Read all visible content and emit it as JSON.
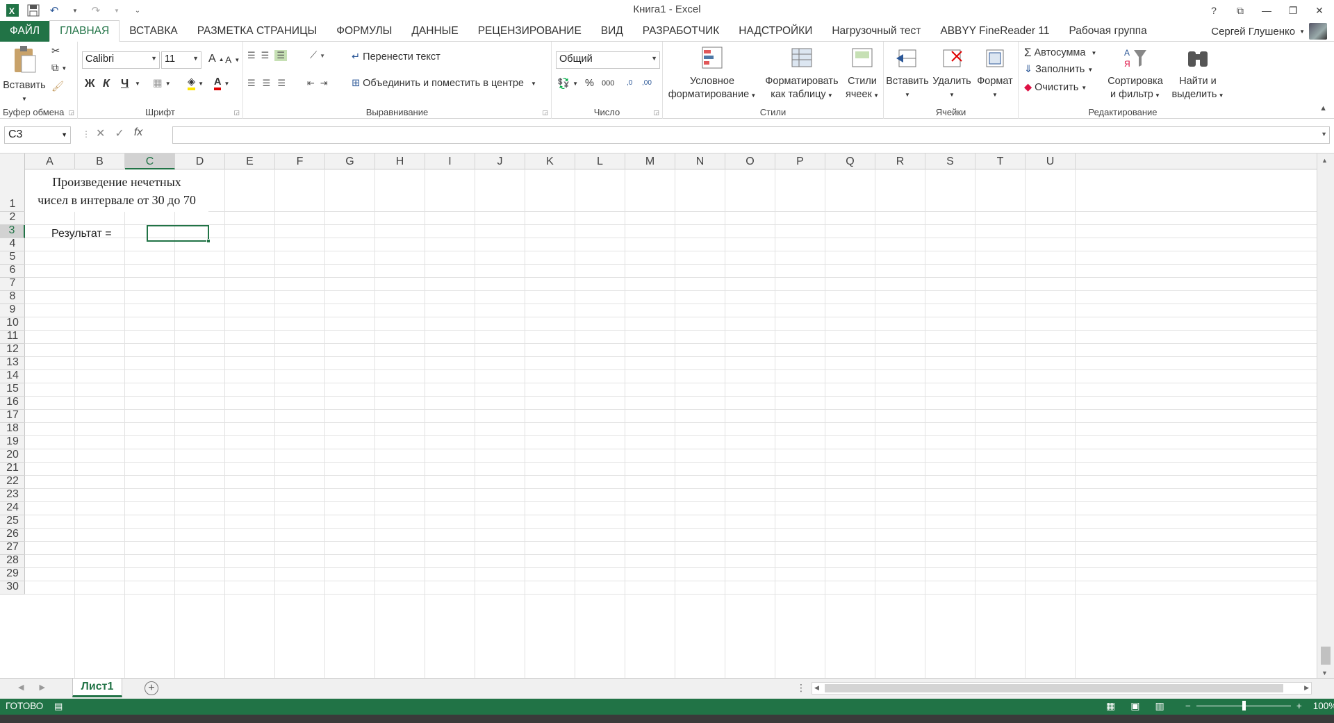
{
  "window": {
    "title": "Книга1 - Excel",
    "controls": [
      "?",
      "⧉",
      "—",
      "❐",
      "✕"
    ]
  },
  "quick_access": {
    "icons": [
      "excel-logo-icon",
      "save-icon",
      "undo-icon",
      "redo-icon",
      "customize-icon"
    ]
  },
  "tabs": [
    {
      "label": "ФАЙЛ"
    },
    {
      "label": "ГЛАВНАЯ"
    },
    {
      "label": "ВСТАВКА"
    },
    {
      "label": "РАЗМЕТКА СТРАНИЦЫ"
    },
    {
      "label": "ФОРМУЛЫ"
    },
    {
      "label": "ДАННЫЕ"
    },
    {
      "label": "РЕЦЕНЗИРОВАНИЕ"
    },
    {
      "label": "ВИД"
    },
    {
      "label": "РАЗРАБОТЧИК"
    },
    {
      "label": "НАДСТРОЙКИ"
    },
    {
      "label": "Нагрузочный тест"
    },
    {
      "label": "ABBYY FineReader 11"
    },
    {
      "label": "Рабочая группа"
    }
  ],
  "user": {
    "name": "Сергей Глушенко"
  },
  "ribbon": {
    "clipboard": {
      "group_label": "Буфер обмена",
      "paste_label": "Вставить"
    },
    "font": {
      "group_label": "Шрифт",
      "font_name": "Calibri",
      "font_size": "11",
      "bold": "Ж",
      "italic": "К",
      "underline": "Ч",
      "grow": "A",
      "shrink": "A",
      "font_color_letter": "A"
    },
    "alignment": {
      "group_label": "Выравнивание",
      "wrap_text": "Перенести текст",
      "merge_center": "Объединить и поместить в центре"
    },
    "number": {
      "group_label": "Число",
      "format": "Общий",
      "percent": "%",
      "thousands": "000",
      "inc_decimal": ",0",
      "dec_decimal": ",00"
    },
    "styles": {
      "group_label": "Стили",
      "conditional_1": "Условное",
      "conditional_2": "форматирование",
      "format_table_1": "Форматировать",
      "format_table_2": "как таблицу",
      "cell_styles_1": "Стили",
      "cell_styles_2": "ячеек"
    },
    "cells": {
      "group_label": "Ячейки",
      "insert": "Вставить",
      "delete": "Удалить",
      "format": "Формат"
    },
    "editing": {
      "group_label": "Редактирование",
      "autosum": "Автосумма",
      "fill": "Заполнить",
      "clear": "Очистить",
      "sort_1": "Сортировка",
      "sort_2": "и фильтр",
      "find_1": "Найти и",
      "find_2": "выделить"
    }
  },
  "formula_bar": {
    "name_box": "C3",
    "formula": "",
    "fx": "fx"
  },
  "columns": [
    "A",
    "B",
    "C",
    "D",
    "E",
    "F",
    "G",
    "H",
    "I",
    "J",
    "K",
    "L",
    "M",
    "N",
    "O",
    "P",
    "Q",
    "R",
    "S",
    "T",
    "U"
  ],
  "selected_column": "C",
  "rows": [
    "1",
    "2",
    "3",
    "4",
    "5",
    "6",
    "7",
    "8",
    "9",
    "10",
    "11",
    "12",
    "13",
    "14",
    "15",
    "16",
    "17",
    "18",
    "19",
    "20",
    "21",
    "22",
    "23",
    "24",
    "25",
    "26",
    "27",
    "28",
    "29",
    "30"
  ],
  "selected_row": "3",
  "cells": {
    "A1_line1": "Произведение нечетных",
    "A1_line2": "чисел в интервале от 30 до 70",
    "A3": "Результат ="
  },
  "sheet_tabs": [
    {
      "label": "Лист1",
      "active": true
    }
  ],
  "status": {
    "ready": "ГОТОВО",
    "zoom": "100%"
  }
}
